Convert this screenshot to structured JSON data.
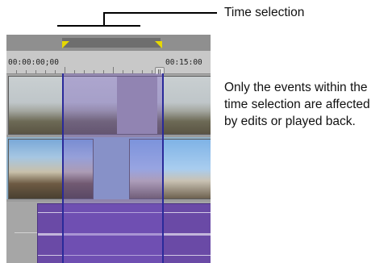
{
  "callouts": {
    "time_selection_label": "Time selection",
    "description": "Only the events within the time selection are affected by edits or played back."
  },
  "timeline": {
    "start_timecode": "00:00:00;00",
    "end_timecode": "00:15:00"
  },
  "colors": {
    "selection_fill": "#785ac8",
    "selection_border": "#2a2a9a",
    "loop_flag": "#e6d800",
    "audio_clip": "#6a4aa6"
  },
  "icons": {
    "marker": "marker-icon"
  }
}
